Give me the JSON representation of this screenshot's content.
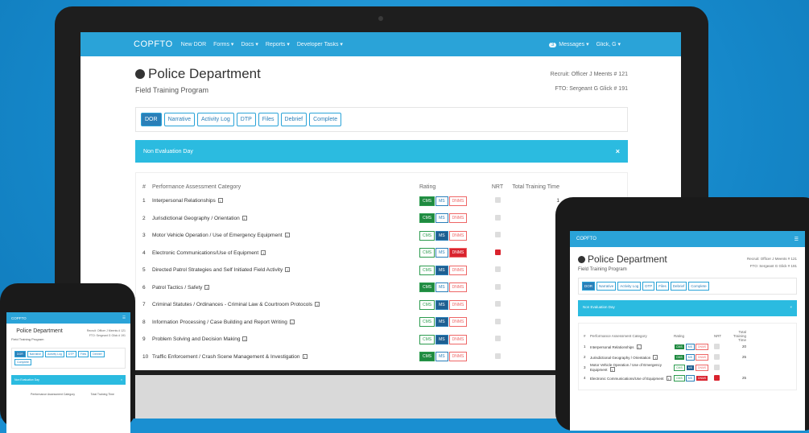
{
  "nav": {
    "brand": "COPFTO",
    "items": [
      "New DOR",
      "Forms ▾",
      "Docs ▾",
      "Reports ▾",
      "Developer Tasks ▾"
    ],
    "messages_count": "3",
    "messages_label": "Messages ▾",
    "user": "Glick, G ▾"
  },
  "header": {
    "title": "Police Department",
    "subtitle": "Field Training Program",
    "recruit": "Recruit: Officer J Meents # 121",
    "fto": "FTO: Sergeant G Glick # 191"
  },
  "tabs": [
    "DOR",
    "Narrative",
    "Activity Log",
    "DTP",
    "Files",
    "Debrief",
    "Complete"
  ],
  "alert": {
    "text": "Non Evaluation Day",
    "close": "×"
  },
  "table": {
    "headers": {
      "num": "#",
      "category": "Performance Assessment Category",
      "rating": "Rating",
      "nrt": "NRT",
      "time": "Total Training Time"
    },
    "rows": [
      {
        "num": "1",
        "category": "Interpersonal Relationships",
        "rating": "CMS",
        "nrt": false,
        "time": "1"
      },
      {
        "num": "2",
        "category": "Jurisdictional Geography / Orientation",
        "rating": "CMS",
        "nrt": false,
        "time": ""
      },
      {
        "num": "3",
        "category": "Motor Vehicle Operation / Use of Emergency Equipment",
        "rating": "MS",
        "nrt": false,
        "time": ""
      },
      {
        "num": "4",
        "category": "Electronic Communications/Use of Equipment",
        "rating": "DNMS",
        "nrt": true,
        "time": ""
      },
      {
        "num": "5",
        "category": "Directed Patrol Strategies and Self Initiated Field Activity",
        "rating": "MS",
        "nrt": false,
        "time": ""
      },
      {
        "num": "6",
        "category": "Patrol Tactics / Safety",
        "rating": "CMS",
        "nrt": false,
        "time": ""
      },
      {
        "num": "7",
        "category": "Criminal Statutes / Ordinances - Criminal Law & Courtroom Protocols",
        "rating": "MS",
        "nrt": false,
        "time": ""
      },
      {
        "num": "8",
        "category": "Information Processing / Case Building and Report Writing",
        "rating": "MS",
        "nrt": false,
        "time": ""
      },
      {
        "num": "9",
        "category": "Problem Solving and Decision Making",
        "rating": "MS",
        "nrt": false,
        "time": ""
      },
      {
        "num": "10",
        "category": "Traffic Enforcement / Crash Scene Management & Investigation",
        "rating": "CMS",
        "nrt": false,
        "time": ""
      }
    ],
    "rating_labels": [
      "CMS",
      "MS",
      "DNMS"
    ]
  },
  "tablet": {
    "brand": "COPFTO",
    "menu_icon": "hamburger-icon",
    "headers": {
      "num": "#",
      "category": "Performance Assessment Category",
      "rating": "Rating",
      "nrt": "NRT",
      "time": "Total Training Time"
    },
    "rows": [
      {
        "num": "1",
        "category": "Interpersonal Relationships",
        "rating": "CMS",
        "nrt": false,
        "time": "20"
      },
      {
        "num": "2",
        "category": "Jurisdictional Geography / Orientation",
        "rating": "CMS",
        "nrt": false,
        "time": "25"
      },
      {
        "num": "3",
        "category": "Motor Vehicle Operation / Use of Emergency Equipment",
        "rating": "MS",
        "nrt": false,
        "time": ""
      },
      {
        "num": "4",
        "category": "Electronic Communications/Use of Equipment",
        "rating": "DNMS",
        "nrt": true,
        "time": "25"
      }
    ]
  },
  "phone": {
    "brand": "COPFTO",
    "title": "Police Department",
    "tabs": [
      "DOR",
      "Narrative",
      "Activity Log",
      "DTP",
      "Files",
      "Debrief",
      "Complete"
    ]
  },
  "colors": {
    "primary": "#2aa3d8",
    "cms": "#1f8a40",
    "ms": "#1f5f91",
    "dnms": "#d9232e",
    "background": "#1a8fd1"
  }
}
